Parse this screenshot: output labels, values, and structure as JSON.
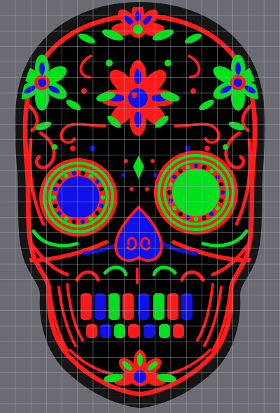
{
  "image": {
    "subject": "sugar-skull",
    "background_color": "#6b6b73",
    "grid_line_color": "#a4a4ac",
    "outline_color": "#1a1a1a",
    "skull_fill": "#000000",
    "palette": {
      "red": "#ff1a1a",
      "green": "#00e01c",
      "blue": "#1010e8"
    }
  }
}
